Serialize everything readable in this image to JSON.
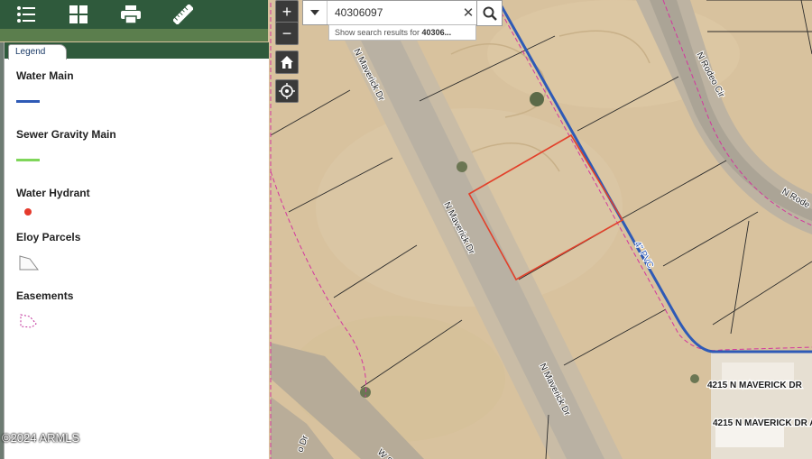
{
  "toolbar": {
    "items": [
      {
        "name": "layer-list-icon"
      },
      {
        "name": "basemap-grid-icon"
      },
      {
        "name": "print-icon"
      },
      {
        "name": "measure-ruler-icon"
      }
    ]
  },
  "legend": {
    "tab_label": "Legend",
    "entries": [
      {
        "title": "Water Main",
        "symbol": "line",
        "color": "#2e5ab6"
      },
      {
        "title": "Sewer Gravity Main",
        "symbol": "line",
        "color": "#7fd65a"
      },
      {
        "title": "Water Hydrant",
        "symbol": "dot",
        "color": "#e53a2c"
      },
      {
        "title": "Eloy Parcels",
        "symbol": "polygon"
      },
      {
        "title": "Easements",
        "symbol": "dashed-polygon",
        "color": "#c0309a"
      }
    ]
  },
  "map_controls": {
    "zoom_in": "+",
    "zoom_out": "−"
  },
  "search": {
    "value": "40306097",
    "clear": "✕",
    "suggestion_prefix": "Show search results for ",
    "suggestion_bold": "40306..."
  },
  "map_labels": {
    "maverick_1": "N Maverick Dr",
    "maverick_2": "N Maverick Dr",
    "maverick_3": "N Maverick Dr",
    "rodeo_1": "N Rodeo Cir",
    "rodeo_2": "N Rode",
    "pipe": "4\" PVC",
    "address_1": "4215 N MAVERICK DR",
    "address_2": "4215 N MAVERICK DR A",
    "road_sw": "W S",
    "road_sw2": "o Dr"
  },
  "colors": {
    "water_main": "#2e5ab6",
    "parcel_line": "#2b2b2b",
    "easement": "#d4359e",
    "highlight": "#e2402a"
  },
  "copyright": "©2024 ARMLS"
}
